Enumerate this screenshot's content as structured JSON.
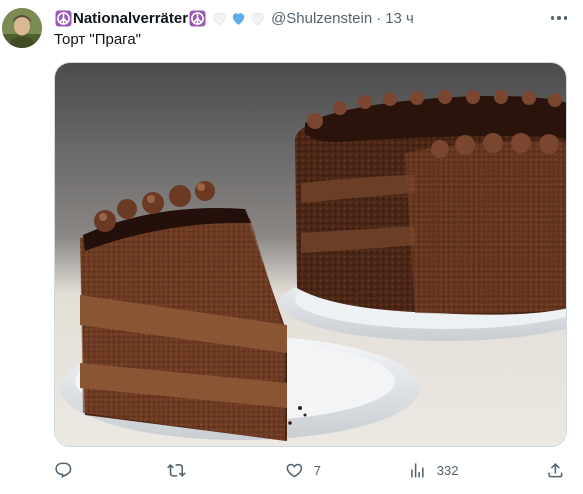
{
  "tweet": {
    "author": {
      "display_name": "Nationalverräter",
      "handle": "@Shulzenstein",
      "name_emojis": [
        "peace-symbol",
        "peace-symbol",
        "white-heart",
        "blue-heart",
        "white-heart"
      ]
    },
    "separator": "·",
    "timestamp": "13 ч",
    "text": "Торт \"Прага\"",
    "media": {
      "subject": "photo",
      "colors": {
        "cake_dark": "#3a1e12",
        "cream": "#7a4a30",
        "plate": "#e9ecef",
        "background": "#ece8e2"
      }
    },
    "actions": {
      "reply": {
        "icon": "reply-icon",
        "count": ""
      },
      "retweet": {
        "icon": "retweet-icon",
        "count": ""
      },
      "like": {
        "icon": "heart-icon",
        "count": "7"
      },
      "views": {
        "icon": "views-icon",
        "count": "332"
      },
      "share": {
        "icon": "share-icon"
      }
    }
  },
  "colors": {
    "text_primary": "#0f1419",
    "text_secondary": "#536471",
    "border": "#cfd9de",
    "peace_purple": "#9b59b6",
    "heart_blue": "#5dadec"
  }
}
